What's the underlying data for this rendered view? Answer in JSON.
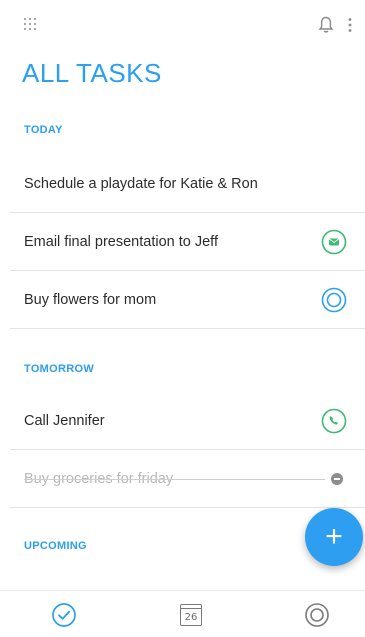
{
  "header": {
    "title": "ALL TASKS",
    "menu_icon": "grid-icon",
    "notification_icon": "bell-icon",
    "overflow_icon": "more-vertical-icon"
  },
  "sections": [
    {
      "label": "TODAY",
      "tasks": [
        {
          "label": "Schedule a playdate for Katie & Ron",
          "action_icon": null
        },
        {
          "label": "Email final presentation to Jeff",
          "action_icon": "email-icon"
        },
        {
          "label": "Buy flowers for mom",
          "action_icon": "location-icon"
        }
      ]
    },
    {
      "label": "TOMORROW",
      "tasks": [
        {
          "label": "Call Jennifer",
          "action_icon": "phone-icon"
        },
        {
          "label": "Buy groceries for friday",
          "completed": true,
          "action_icon": "remove-icon"
        }
      ]
    },
    {
      "label": "UPCOMING",
      "tasks": []
    }
  ],
  "fab": {
    "label": "+",
    "icon": "plus-icon"
  },
  "bottom_nav": [
    {
      "name": "tasks",
      "icon": "check-circle-icon",
      "active": true
    },
    {
      "name": "calendar",
      "icon": "calendar-icon",
      "text": "26"
    },
    {
      "name": "places",
      "icon": "target-icon"
    }
  ],
  "colors": {
    "accent": "#2b9ff0",
    "green": "#3cba6f",
    "text": "#2c2c2c",
    "completed_text": "#b9b9b9"
  }
}
